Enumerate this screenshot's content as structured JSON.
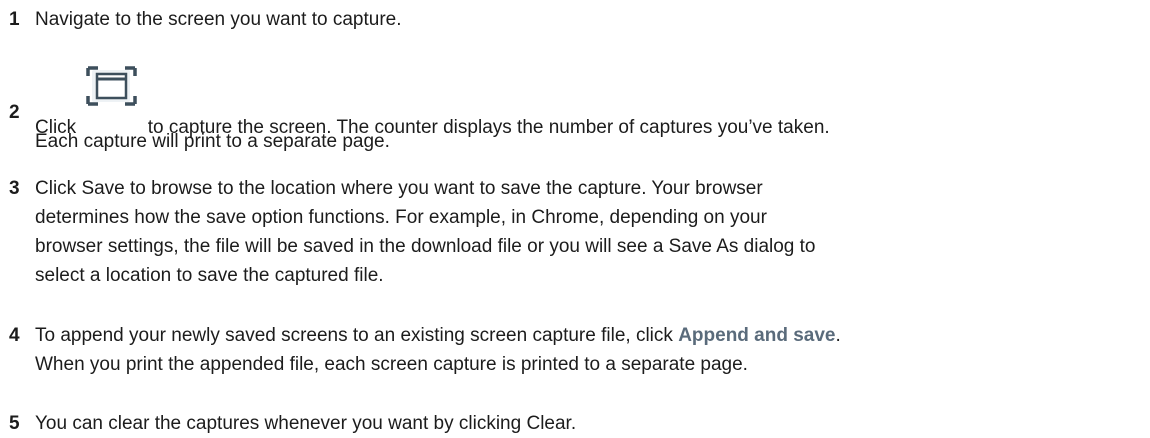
{
  "steps": [
    {
      "number": "1",
      "text": "Navigate to the screen you want to capture."
    },
    {
      "number": "2",
      "text_before": "Click",
      "icon": "screen-capture-icon",
      "text_after": "to capture the screen. The counter displays the number of captures you’ve taken.",
      "line2": "Each capture will print to a separate page."
    },
    {
      "number": "3",
      "lines": [
        "Click Save to browse to the location where you want to save the capture. Your browser",
        "determines how the save option functions. For example, in Chrome, depending on your",
        "browser settings, the file will be saved in the download file or you will see a Save As dialog to",
        "select a location to save the captured file."
      ]
    },
    {
      "number": "4",
      "text_before": "To append your newly saved screens to an existing screen capture file, click",
      "link_text": "Append and save",
      "text_after": ".",
      "line2": "When you print the appended file, each screen capture is printed to a separate page."
    },
    {
      "number": "5",
      "text": "You can clear the captures whenever you want by clicking Clear."
    }
  ],
  "colors": {
    "text": "#1c1c1c",
    "link": "#5a6b7b",
    "icon_stroke": "#3d4f5c",
    "icon_bg": "#eef2f5"
  }
}
